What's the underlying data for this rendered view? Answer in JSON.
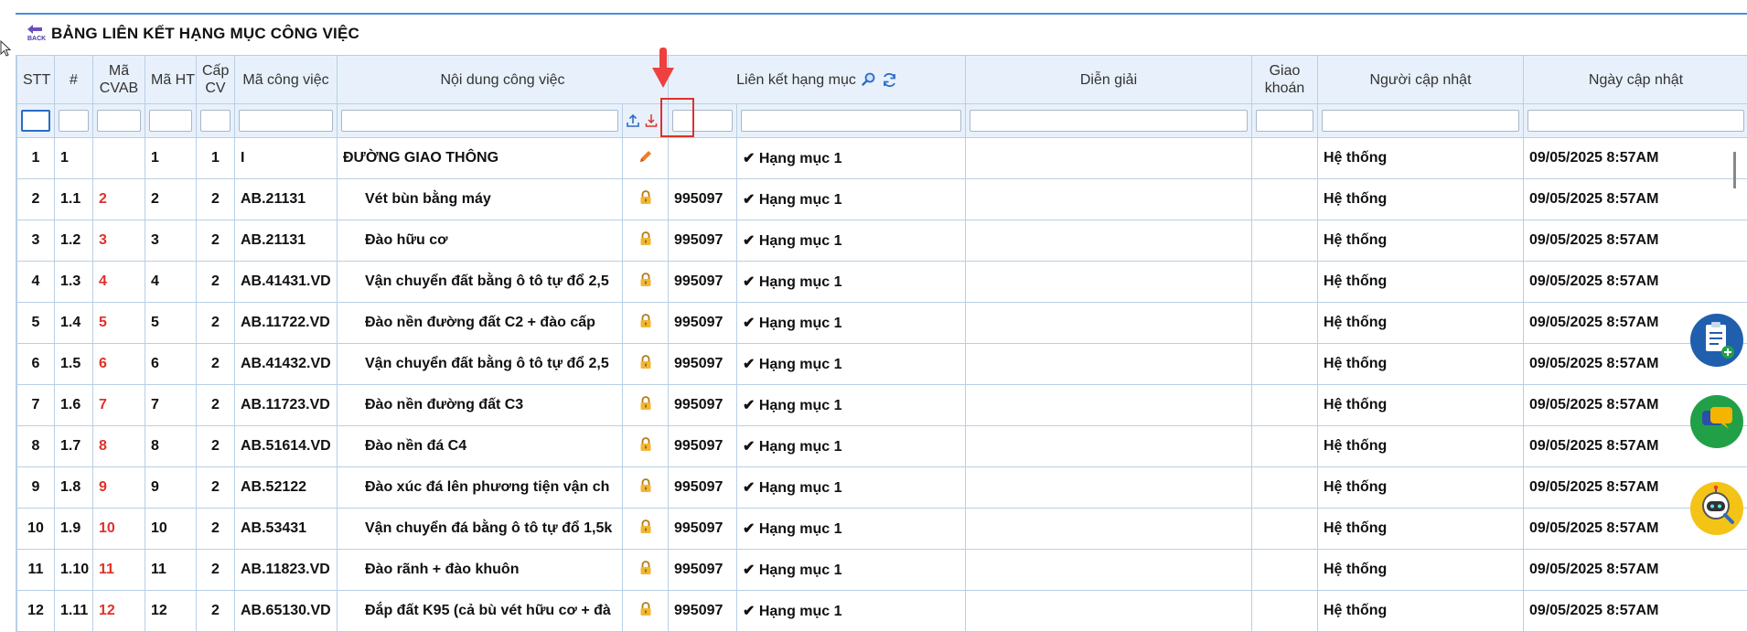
{
  "header": {
    "back_label": "BACK",
    "title": "BẢNG LIÊN KẾT HẠNG MỤC CÔNG VIỆC"
  },
  "columns": {
    "stt": "STT",
    "hash": "#",
    "ma_cvab_1": "Mã",
    "ma_cvab_2": "CVAB",
    "ma_ht": "Mã HT",
    "cap_cv_1": "Cấp",
    "cap_cv_2": "CV",
    "ma_cong_viec": "Mã công việc",
    "noi_dung": "Nội dung công việc",
    "lien_ket": "Liên kết hạng mục",
    "dien_giai": "Diễn giải",
    "giao_khoan_1": "Giao",
    "giao_khoan_2": "khoán",
    "nguoi_cap_nhat": "Người cập nhật",
    "ngay_cap_nhat": "Ngày cập nhật"
  },
  "icons": {
    "back": "back-arrow-icon",
    "search": "search-icon",
    "refresh": "refresh-icon",
    "upload": "upload-icon",
    "download": "download-icon",
    "edit": "pencil-icon",
    "lock": "lock-icon"
  },
  "colors": {
    "accent": "#4a90d9",
    "header_bg": "#e8f1fb",
    "highlight": "#e0302a"
  },
  "rows": [
    {
      "stt": "1",
      "hash": "1",
      "ma_cvab": "",
      "ma_ht": "1",
      "cap": "1",
      "ma_cv": "I",
      "noi_dung": "ĐƯỜNG GIAO THÔNG",
      "status": "edit",
      "lien_ket_code": "",
      "hang_muc": "✔ Hạng mục 1",
      "dien_giai": "",
      "giao_khoan": "",
      "nguoi": "Hệ thống",
      "ngay": "09/05/2025 8:57AM"
    },
    {
      "stt": "2",
      "hash": "1.1",
      "ma_cvab": "2",
      "ma_ht": "2",
      "cap": "2",
      "ma_cv": "AB.21131",
      "noi_dung": "Vét bùn bằng máy",
      "status": "lock",
      "lien_ket_code": "995097",
      "hang_muc": "✔ Hạng mục 1",
      "dien_giai": "",
      "giao_khoan": "",
      "nguoi": "Hệ thống",
      "ngay": "09/05/2025 8:57AM"
    },
    {
      "stt": "3",
      "hash": "1.2",
      "ma_cvab": "3",
      "ma_ht": "3",
      "cap": "2",
      "ma_cv": "AB.21131",
      "noi_dung": "Đào hữu cơ",
      "status": "lock",
      "lien_ket_code": "995097",
      "hang_muc": "✔ Hạng mục 1",
      "dien_giai": "",
      "giao_khoan": "",
      "nguoi": "Hệ thống",
      "ngay": "09/05/2025 8:57AM"
    },
    {
      "stt": "4",
      "hash": "1.3",
      "ma_cvab": "4",
      "ma_ht": "4",
      "cap": "2",
      "ma_cv": "AB.41431.VD",
      "noi_dung": "Vận chuyển đất bằng ô tô tự đổ 2,5",
      "status": "lock",
      "lien_ket_code": "995097",
      "hang_muc": "✔ Hạng mục 1",
      "dien_giai": "",
      "giao_khoan": "",
      "nguoi": "Hệ thống",
      "ngay": "09/05/2025 8:57AM"
    },
    {
      "stt": "5",
      "hash": "1.4",
      "ma_cvab": "5",
      "ma_ht": "5",
      "cap": "2",
      "ma_cv": "AB.11722.VD",
      "noi_dung": "Đào nền đường đất C2 + đào cấp",
      "status": "lock",
      "lien_ket_code": "995097",
      "hang_muc": "✔ Hạng mục 1",
      "dien_giai": "",
      "giao_khoan": "",
      "nguoi": "Hệ thống",
      "ngay": "09/05/2025 8:57AM"
    },
    {
      "stt": "6",
      "hash": "1.5",
      "ma_cvab": "6",
      "ma_ht": "6",
      "cap": "2",
      "ma_cv": "AB.41432.VD",
      "noi_dung": "Vận chuyển đất bằng ô tô tự đổ 2,5",
      "status": "lock",
      "lien_ket_code": "995097",
      "hang_muc": "✔ Hạng mục 1",
      "dien_giai": "",
      "giao_khoan": "",
      "nguoi": "Hệ thống",
      "ngay": "09/05/2025 8:57AM"
    },
    {
      "stt": "7",
      "hash": "1.6",
      "ma_cvab": "7",
      "ma_ht": "7",
      "cap": "2",
      "ma_cv": "AB.11723.VD",
      "noi_dung": "Đào nền đường đất C3",
      "status": "lock",
      "lien_ket_code": "995097",
      "hang_muc": "✔ Hạng mục 1",
      "dien_giai": "",
      "giao_khoan": "",
      "nguoi": "Hệ thống",
      "ngay": "09/05/2025 8:57AM"
    },
    {
      "stt": "8",
      "hash": "1.7",
      "ma_cvab": "8",
      "ma_ht": "8",
      "cap": "2",
      "ma_cv": "AB.51614.VD",
      "noi_dung": "Đào nền đá C4",
      "status": "lock",
      "lien_ket_code": "995097",
      "hang_muc": "✔ Hạng mục 1",
      "dien_giai": "",
      "giao_khoan": "",
      "nguoi": "Hệ thống",
      "ngay": "09/05/2025 8:57AM"
    },
    {
      "stt": "9",
      "hash": "1.8",
      "ma_cvab": "9",
      "ma_ht": "9",
      "cap": "2",
      "ma_cv": "AB.52122",
      "noi_dung": "Đào xúc đá lên phương tiện vận ch",
      "status": "lock",
      "lien_ket_code": "995097",
      "hang_muc": "✔ Hạng mục 1",
      "dien_giai": "",
      "giao_khoan": "",
      "nguoi": "Hệ thống",
      "ngay": "09/05/2025 8:57AM"
    },
    {
      "stt": "10",
      "hash": "1.9",
      "ma_cvab": "10",
      "ma_ht": "10",
      "cap": "2",
      "ma_cv": "AB.53431",
      "noi_dung": "Vận chuyển đá bằng ô tô tự đổ 1,5k",
      "status": "lock",
      "lien_ket_code": "995097",
      "hang_muc": "✔ Hạng mục 1",
      "dien_giai": "",
      "giao_khoan": "",
      "nguoi": "Hệ thống",
      "ngay": "09/05/2025 8:57AM"
    },
    {
      "stt": "11",
      "hash": "1.10",
      "ma_cvab": "11",
      "ma_ht": "11",
      "cap": "2",
      "ma_cv": "AB.11823.VD",
      "noi_dung": "Đào rãnh + đào khuôn",
      "status": "lock",
      "lien_ket_code": "995097",
      "hang_muc": "✔ Hạng mục 1",
      "dien_giai": "",
      "giao_khoan": "",
      "nguoi": "Hệ thống",
      "ngay": "09/05/2025 8:57AM"
    },
    {
      "stt": "12",
      "hash": "1.11",
      "ma_cvab": "12",
      "ma_ht": "12",
      "cap": "2",
      "ma_cv": "AB.65130.VD",
      "noi_dung": "Đắp đất K95 (cả bù vét hữu cơ + đà",
      "status": "lock",
      "lien_ket_code": "995097",
      "hang_muc": "✔ Hạng mục 1",
      "dien_giai": "",
      "giao_khoan": "",
      "nguoi": "Hệ thống",
      "ngay": "09/05/2025 8:57AM"
    }
  ]
}
